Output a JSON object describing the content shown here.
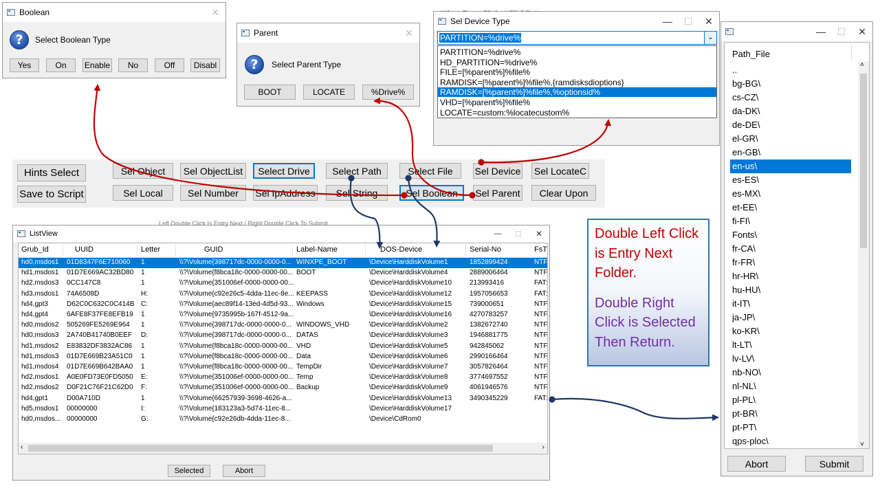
{
  "boolean_dialog": {
    "title": "Boolean",
    "prompt": "Select Boolean Type",
    "buttons": [
      "Yes",
      "On",
      "Enable",
      "No",
      "Off",
      "Disabl"
    ]
  },
  "parent_dialog": {
    "title": "Parent",
    "prompt": "Select Parent Type",
    "buttons": [
      "BOOT",
      "LOCATE",
      "%Drive%"
    ]
  },
  "device_dialog": {
    "title": "Sel Device Type",
    "background_text": "When Press [Select File] Button",
    "combo_value": "PARTITION=%drive%",
    "options": [
      "PARTITION=%drive%",
      "HD_PARTITION=%drive%",
      "FILE=[%parent%]%file%",
      "RAMDISK=[%parent%]%file%,{ramdisksdioptions}",
      "RAMDISK=[%parent%]%file%,%optionsid%",
      "VHD=[%parent%]%file%",
      "LOCATE=custom:%locatecustom%"
    ],
    "selected_index": 4
  },
  "toolbar": {
    "hints": "Hints Select",
    "save": "Save to Script",
    "row1": [
      "Sel Object",
      "Sel ObjectList",
      "Select Drive",
      "Select Path",
      "Select File",
      "Sel Device",
      "Sel LocateC"
    ],
    "row2": [
      "Sel Local",
      "Sel Number",
      "Sel IpAddress",
      "Sel String",
      "Sel Boolean",
      "Sel Parent",
      "Clear Upon"
    ]
  },
  "listview": {
    "title": "ListView",
    "background_text": "Left Double Click Is Entry Next / Right Double Click To Submit",
    "columns": [
      "Grub_Id",
      "UUID",
      "Letter",
      "GUID",
      "Label-Name",
      "DOS-Device",
      "Serial-No",
      "FsT"
    ],
    "rows": [
      [
        "hd0,msdos1",
        "01D8347F6E710060",
        "1",
        "\\\\?\\Volume{398717dc-0000-0000-0...",
        "WINXPE_BOOT",
        "\\Device\\HarddiskVolume1",
        "1852899424",
        "NTF"
      ],
      [
        "hd1,msdos1",
        "01D7E669AC32BD80",
        "1",
        "\\\\?\\Volume{f8bca18c-0000-0000-00...",
        "BOOT",
        "\\Device\\HarddiskVolume4",
        "2889006464",
        "NTF"
      ],
      [
        "hd2,msdos3",
        "0CC147C8",
        "1",
        "\\\\?\\Volume{351006ef-0000-0000-00...",
        "",
        "\\Device\\HarddiskVolume10",
        "213993416",
        "FAT:"
      ],
      [
        "hd3,msdos1",
        "74A6508D",
        "H:",
        "\\\\?\\Volume{c92e26c5-4dda-11ec-8e...",
        "KEEPASS",
        "\\Device\\HarddiskVolume12",
        "1957056653",
        "FAT:"
      ],
      [
        "hd4,gpt3",
        "D62C0C632C0C414B",
        "C:",
        "\\\\?\\Volume{aec89f14-13ed-4d5d-93...",
        "Windows",
        "\\Device\\HarddiskVolume15",
        "739000651",
        "NTF"
      ],
      [
        "hd4,gpt4",
        "6AFE8F37FE8EFB19",
        "1",
        "\\\\?\\Volume{9735995b-167f-4512-9a...",
        "",
        "\\Device\\HarddiskVolume16",
        "4270783257",
        "NTF"
      ],
      [
        "hd0,msdos2",
        "505269FE5269E964",
        "1",
        "\\\\?\\Volume{398717dc-0000-0000-0...",
        "WINDOWS_VHD",
        "\\Device\\HarddiskVolume2",
        "1382672740",
        "NTF"
      ],
      [
        "hd0,msdos3",
        "2A740B41740B0EEF",
        "D:",
        "\\\\?\\Volume{398717dc-0000-0000-0...",
        "DATAS",
        "\\Device\\HarddiskVolume3",
        "1946881775",
        "NTF"
      ],
      [
        "hd1,msdos2",
        "E83832DF3832AC86",
        "1",
        "\\\\?\\Volume{f8bca18c-0000-0000-00...",
        "VHD",
        "\\Device\\HarddiskVolume5",
        "942845062",
        "NTF"
      ],
      [
        "hd1,msdos3",
        "01D7E669B23A51C0",
        "1",
        "\\\\?\\Volume{f8bca18c-0000-0000-00...",
        "Data",
        "\\Device\\HarddiskVolume6",
        "2990166464",
        "NTF"
      ],
      [
        "hd1,msdos4",
        "01D7E669B642BAA0",
        "1",
        "\\\\?\\Volume{f8bca18c-0000-0000-00...",
        "TempDir",
        "\\Device\\HarddiskVolume7",
        "3057826464",
        "NTF"
      ],
      [
        "hd2,msdos1",
        "A0E0FD73E0FD5050",
        "E:",
        "\\\\?\\Volume{351006ef-0000-0000-00...",
        "Temp",
        "\\Device\\HarddiskVolume8",
        "3774697552",
        "NTF"
      ],
      [
        "hd2,msdos2",
        "D0F21C76F21C62D0",
        "F:",
        "\\\\?\\Volume{351006ef-0000-0000-00...",
        "Backup",
        "\\Device\\HarddiskVolume9",
        "4061946576",
        "NTF"
      ],
      [
        "hd4,gpt1",
        "D00A710D",
        "1",
        "\\\\?\\Volume{66257939-3698-4626-a...",
        "",
        "\\Device\\HarddiskVolume13",
        "3490345229",
        "FAT:"
      ],
      [
        "hd5,msdos1",
        "00000000",
        "I:",
        "\\\\?\\Volume{183123a3-5d74-11ec-8...",
        "",
        "\\Device\\HarddiskVolume17",
        "",
        ""
      ],
      [
        "hd0,msdos...",
        "00000000",
        "G:",
        "\\\\?\\Volume{c92e26db-4dda-11ec-8...",
        "",
        "\\Device\\CdRom0",
        "",
        ""
      ]
    ],
    "selected_row": 0,
    "buttons": [
      "Selected",
      "Abort"
    ]
  },
  "note": {
    "line1": "Double Left Click is Entry Next Folder.",
    "line2": "Double Right Click is Selected Then Return."
  },
  "path_dialog": {
    "title": "",
    "header": "Path_File",
    "items": [
      "..",
      "bg-BG\\",
      "cs-CZ\\",
      "da-DK\\",
      "de-DE\\",
      "el-GR\\",
      "en-GB\\",
      "en-us\\",
      "es-ES\\",
      "es-MX\\",
      "et-EE\\",
      "fi-FI\\",
      "Fonts\\",
      "fr-CA\\",
      "fr-FR\\",
      "hr-HR\\",
      "hu-HU\\",
      "it-IT\\",
      "ja-JP\\",
      "ko-KR\\",
      "lt-LT\\",
      "lv-LV\\",
      "nb-NO\\",
      "nl-NL\\",
      "pl-PL\\",
      "pt-BR\\",
      "pt-PT\\",
      "qps-ploc\\"
    ],
    "selected_index": 7,
    "buttons": [
      "Abort",
      "Submit"
    ]
  },
  "colors": {
    "selection": "#0078d7",
    "arrow_red": "#c00000",
    "arrow_navy": "#1f3864",
    "note_red": "#c00000",
    "note_purple": "#7030a0"
  }
}
